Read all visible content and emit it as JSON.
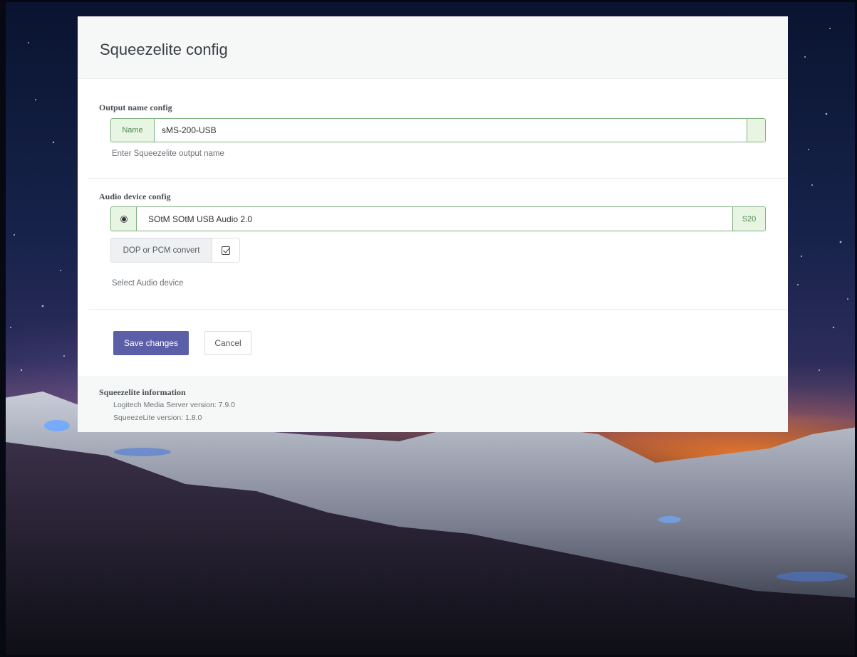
{
  "dialog": {
    "title": "Squeezelite config"
  },
  "output_name": {
    "section_label": "Output name config",
    "addon_label": "Name",
    "value": "sMS-200-USB",
    "help": "Enter Squeezelite output name"
  },
  "audio_device": {
    "section_label": "Audio device config",
    "device_name": "SOtM SOtM USB Audio 2.0",
    "badge": "S20",
    "selected": true,
    "convert_label": "DOP or PCM convert",
    "convert_checked": true,
    "help": "Select Audio device"
  },
  "actions": {
    "save_label": "Save changes",
    "cancel_label": "Cancel"
  },
  "info": {
    "title": "Squeezelite information",
    "lms_version": "Logitech Media Server version: 7.9.0",
    "squeezelite_version": "SqueezeLite version: 1.8.0"
  },
  "colors": {
    "primary": "#5b5fa8",
    "success_border": "#7fb27f",
    "success_bg": "#e8f5e2"
  }
}
